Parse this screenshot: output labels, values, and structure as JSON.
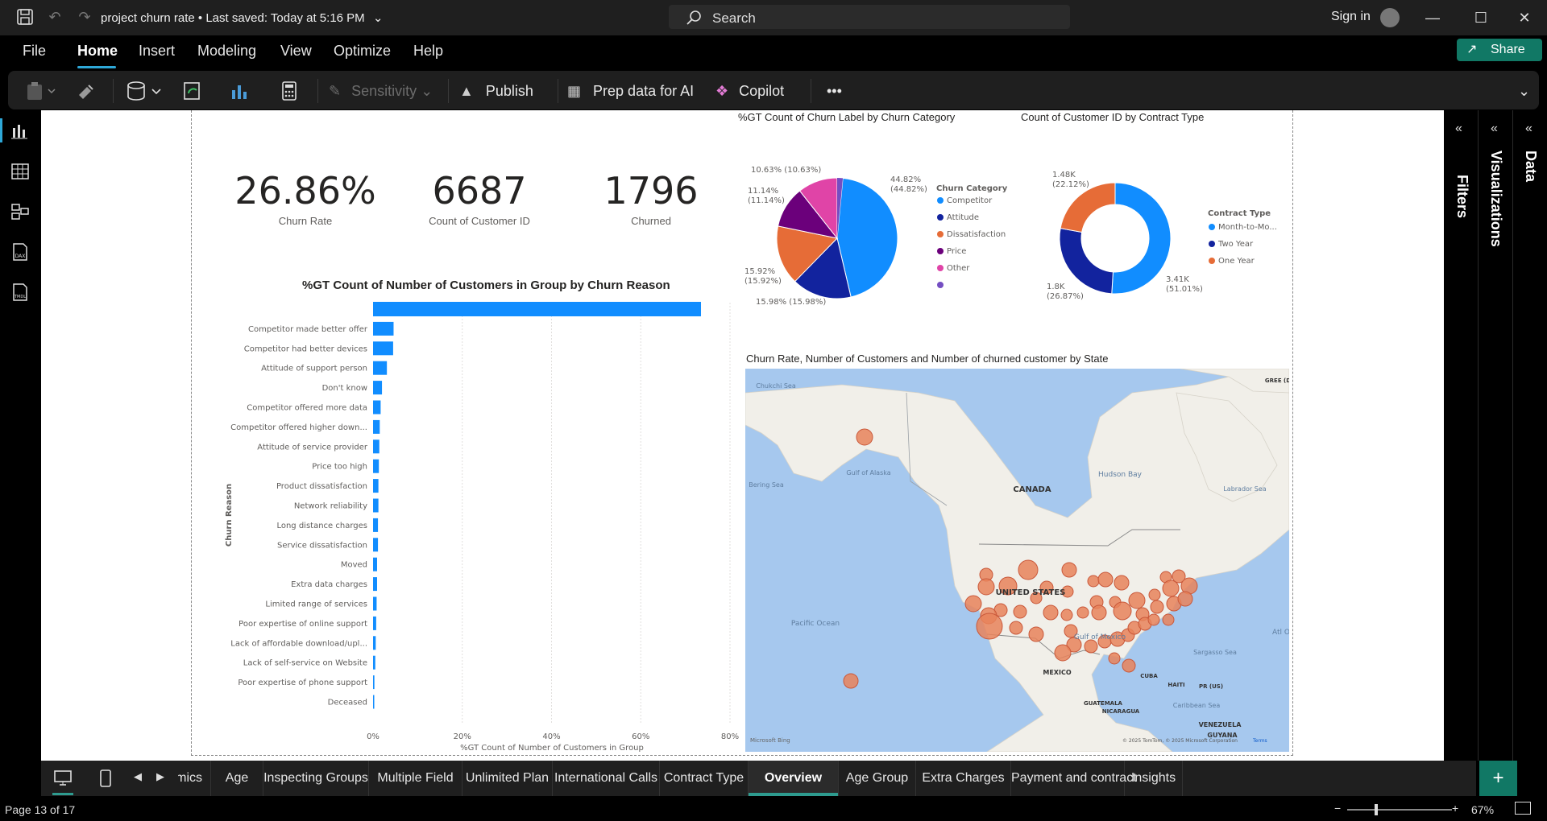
{
  "window": {
    "title": "project churn rate",
    "saved": "• Last saved: Today at 5:16 PM",
    "search_label": "Search",
    "signin": "Sign in"
  },
  "menu": [
    "File",
    "Home",
    "Insert",
    "Modeling",
    "View",
    "Optimize",
    "Help"
  ],
  "share_label": "Share",
  "ribbon": {
    "sensitivity": "Sensitivity",
    "publish": "Publish",
    "prep": "Prep data for AI",
    "copilot": "Copilot",
    "more": "•••"
  },
  "kpis": [
    {
      "value": "26.86%",
      "label": "Churn Rate"
    },
    {
      "value": "6687",
      "label": "Count of Customer ID"
    },
    {
      "value": "1796",
      "label": "Churned"
    }
  ],
  "bar_chart": {
    "title": "%GT Count of Number of Customers in Group by Churn Reason",
    "y_axis_label": "Churn Reason",
    "x_axis_label": "%GT Count of Number of Customers in Group",
    "ticks": [
      "0%",
      "20%",
      "40%",
      "60%",
      "80%"
    ]
  },
  "pie_chart": {
    "title": "%GT Count of Churn Label by Churn Category",
    "legend_title": "Churn Category",
    "labels": [
      "44.82%\n(44.82%)",
      "15.98% (15.98%)",
      "15.92%\n(15.92%)",
      "11.14%\n(11.14%)",
      "10.63% (10.63%)"
    ]
  },
  "donut_chart": {
    "title": "Count of Customer ID by Contract Type",
    "legend_title": "Contract Type",
    "labels": [
      "3.41K\n(51.01%)",
      "1.8K\n(26.87%)",
      "1.48K\n(22.12%)"
    ]
  },
  "map": {
    "title": "Churn Rate, Number of Customers and Number of churned customer by State",
    "places": [
      "Chukchi Sea",
      "Bering Sea",
      "Gulf of Alaska",
      "CANADA",
      "Hudson Bay",
      "Labrador Sea",
      "UNITED STATES",
      "Pacific Ocean",
      "Gulf of Mexico",
      "Sargasso Sea",
      "MEXICO",
      "CUBA",
      "HAITI",
      "PR (US)",
      "GUATEMALA",
      "NICARAGUA",
      "Caribbean Sea",
      "VENEZUELA",
      "GUYANA",
      "GREE (D",
      "Atl O"
    ],
    "credit": "Microsoft Bing",
    "copyright": "© 2025 TomTom, © 2025 Microsoft Corporation",
    "terms": "Terms"
  },
  "panes": {
    "filters": "Filters",
    "visualizations": "Visualizations",
    "data": "Data"
  },
  "tabs": [
    "mics",
    "Age",
    "Inspecting Groups",
    "Multiple Field",
    "Unlimited Plan",
    "International Calls",
    "Contract Type",
    "Overview",
    "Age Group",
    "Extra Charges",
    "Payment and contract",
    "Insights"
  ],
  "active_tab": "Overview",
  "status": {
    "page": "Page 13 of 17",
    "zoom": "67%"
  },
  "colors": {
    "accent_blue": "#118dff",
    "navy": "#12239e",
    "orange": "#e66c37",
    "purple": "#6b007b",
    "pink": "#e044a7",
    "violet": "#744ec2",
    "teal_green": "#117865",
    "map_bubble": "#e8825a"
  },
  "chart_data": [
    {
      "type": "bar",
      "title": "%GT Count of Number of Customers in Group by Churn Reason",
      "ylabel": "Churn Reason",
      "xlabel": "%GT Count of Number of Customers in Group",
      "xlim": [
        0,
        80
      ],
      "categories": [
        "",
        "Competitor made better offer",
        "Competitor had better devices",
        "Attitude of support person",
        "Don't know",
        "Competitor offered more data",
        "Competitor offered higher down...",
        "Attitude of service provider",
        "Price too high",
        "Product dissatisfaction",
        "Network reliability",
        "Long distance charges",
        "Service dissatisfaction",
        "Moved",
        "Extra data charges",
        "Limited range of services",
        "Poor expertise of online support",
        "Lack of affordable download/upl...",
        "Lack of self-service on Website",
        "Poor expertise of phone support",
        "Deceased"
      ],
      "values": [
        73.5,
        4.6,
        4.5,
        3.1,
        2.0,
        1.7,
        1.5,
        1.4,
        1.3,
        1.2,
        1.2,
        1.1,
        1.1,
        0.9,
        0.9,
        0.8,
        0.7,
        0.6,
        0.5,
        0.3,
        0.2
      ]
    },
    {
      "type": "pie",
      "title": "%GT Count of Churn Label by Churn Category",
      "categories": [
        "Competitor",
        "Attitude",
        "Dissatisfaction",
        "Price",
        "Other",
        ""
      ],
      "values": [
        44.82,
        15.98,
        15.92,
        11.14,
        10.63,
        1.51
      ]
    },
    {
      "type": "pie",
      "title": "Count of Customer ID by Contract Type",
      "categories": [
        "Month-to-Mo...",
        "Two Year",
        "One Year"
      ],
      "values": [
        3410,
        1800,
        1480
      ]
    }
  ]
}
